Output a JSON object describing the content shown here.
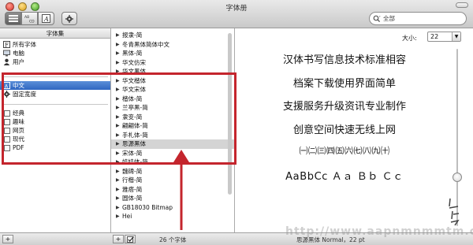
{
  "window": {
    "title": "字体册"
  },
  "toolbar": {
    "search_placeholder": "全部"
  },
  "collections": {
    "header": "字体集",
    "group1": [
      {
        "label": "所有字体",
        "icon": "font-book-icon"
      },
      {
        "label": "电脑",
        "icon": "computer-icon"
      },
      {
        "label": "用户",
        "icon": "user-icon"
      }
    ],
    "group2": [
      {
        "label": "中文",
        "icon": "language-icon",
        "selected": true
      },
      {
        "label": "固定宽度",
        "icon": "gear-icon"
      }
    ],
    "group3": [
      {
        "label": "经典",
        "icon": "collection-icon"
      },
      {
        "label": "趣味",
        "icon": "collection-icon"
      },
      {
        "label": "网页",
        "icon": "collection-icon"
      },
      {
        "label": "现代",
        "icon": "collection-icon"
      },
      {
        "label": "PDF",
        "icon": "collection-icon"
      }
    ]
  },
  "fonts": {
    "items": [
      "报隶-简",
      "冬青黑体简体中文",
      "黑体-简",
      "华文仿宋",
      "华文黑体",
      "华文楷体",
      "华文宋体",
      "楷体-简",
      "兰亭黑-简",
      "隶变-简",
      "翩翩体-简",
      "手札体-简",
      "思源黑体",
      "宋体-简",
      "娃娃体-简",
      "魏碑-简",
      "行楷-简",
      "雅痞-简",
      "圆体-简",
      "GB18030 Bitmap",
      "Hei"
    ],
    "highlighted_index": 12
  },
  "preview": {
    "size_label": "大小:",
    "size_value": "22",
    "lines": [
      "汉体书写信息技术标准相容",
      "档案下载使用界面简单",
      "支援服务升级资讯专业制作",
      "创意空间快速无线上网",
      "㈠㈡㈢㈣㈤㈥㈦㈧㈨㈩",
      "AaBbCc Ａａ Ｂｂ Ｃｃ"
    ]
  },
  "bottombar": {
    "add_label": "+",
    "font_count": "26 个字体",
    "status": "思源黑体 Normal，22 pt"
  },
  "watermark": {
    "text": "http://www.aapnmnmmtm.cc"
  },
  "annotation_color": "#c4252d"
}
